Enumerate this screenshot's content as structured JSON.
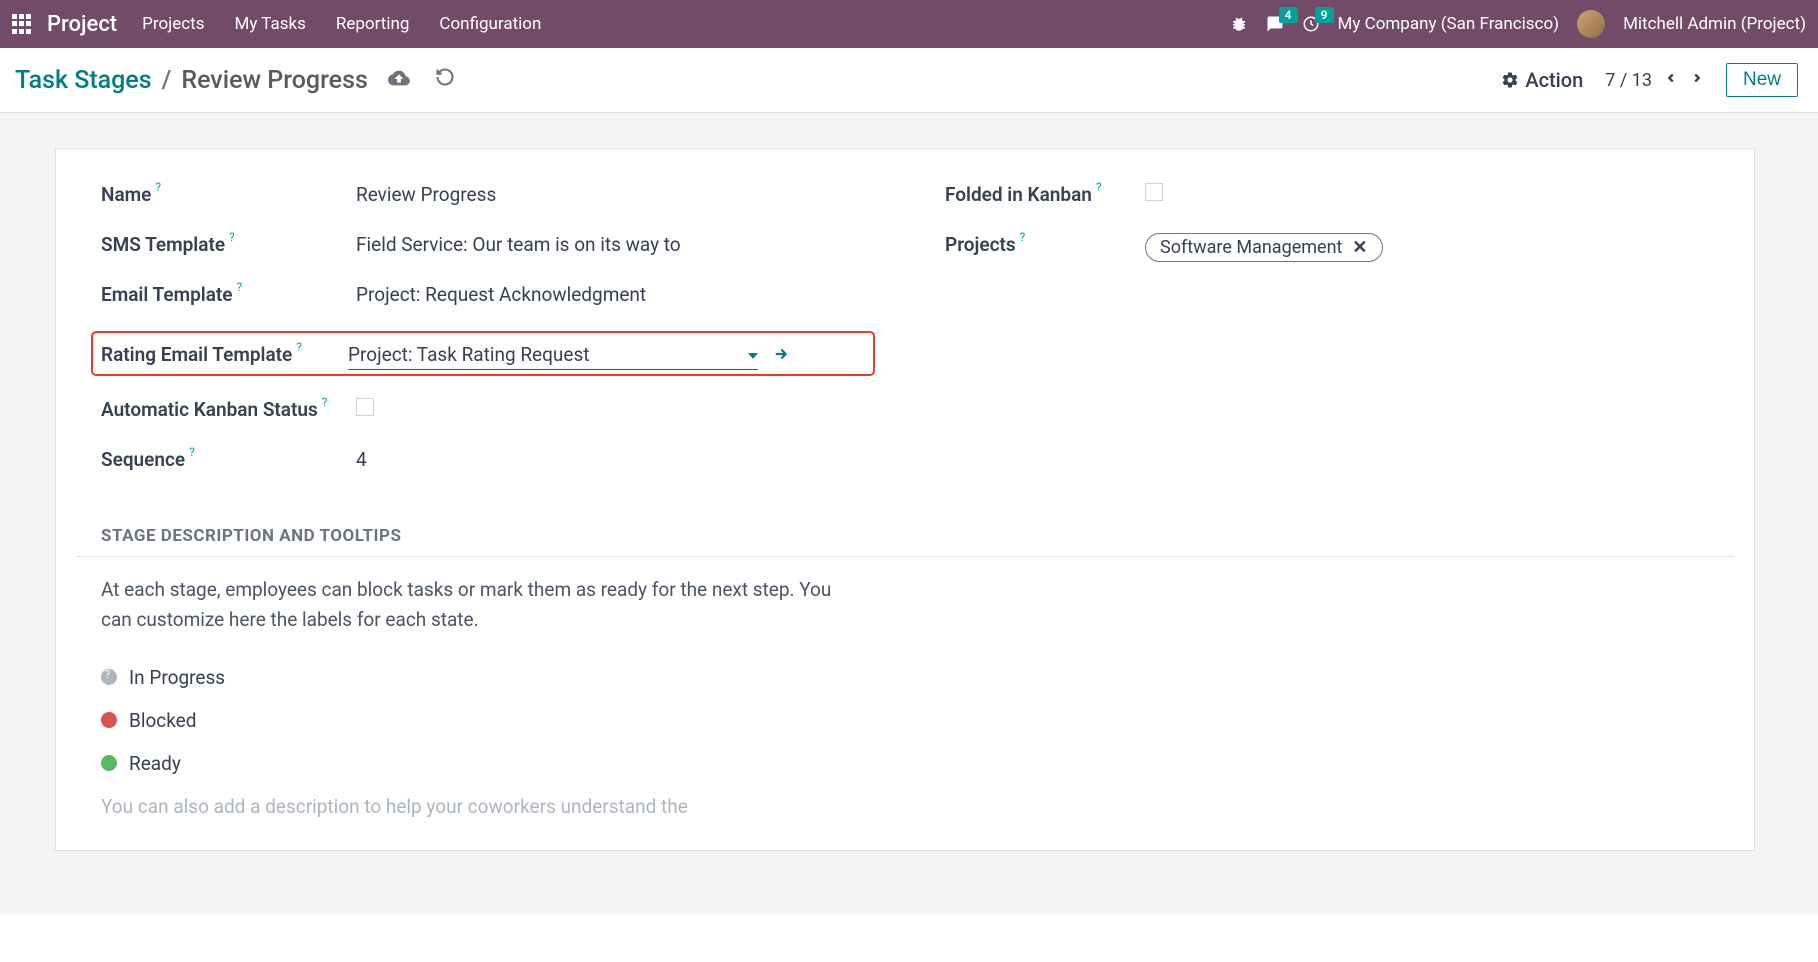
{
  "topbar": {
    "app_title": "Project",
    "nav": [
      "Projects",
      "My Tasks",
      "Reporting",
      "Configuration"
    ],
    "messages_count": "4",
    "activities_count": "9",
    "company": "My Company (San Francisco)",
    "user": "Mitchell Admin (Project)"
  },
  "control_panel": {
    "breadcrumb_root": "Task Stages",
    "breadcrumb_sep": "/",
    "breadcrumb_current": "Review Progress",
    "action_label": "Action",
    "pager": "7 / 13",
    "new_label": "New"
  },
  "form": {
    "labels": {
      "name": "Name",
      "sms_template": "SMS Template",
      "email_template": "Email Template",
      "rating_email_template": "Rating Email Template",
      "auto_kanban": "Automatic Kanban Status",
      "sequence": "Sequence",
      "folded": "Folded in Kanban",
      "projects": "Projects"
    },
    "values": {
      "name": "Review Progress",
      "sms_template": "Field Service: Our team is on its way to",
      "email_template": "Project: Request Acknowledgment",
      "rating_email_template": "Project: Task Rating Request",
      "sequence": "4",
      "project_tag": "Software Management"
    },
    "section_header": "STAGE DESCRIPTION AND TOOLTIPS",
    "section_text": "At each stage, employees can block tasks or mark them as ready for the next step. You can customize here the labels for each state.",
    "legend": {
      "in_progress": "In Progress",
      "blocked": "Blocked",
      "ready": "Ready"
    },
    "footnote": "You can also add a description to help your coworkers understand the"
  },
  "help": "?"
}
